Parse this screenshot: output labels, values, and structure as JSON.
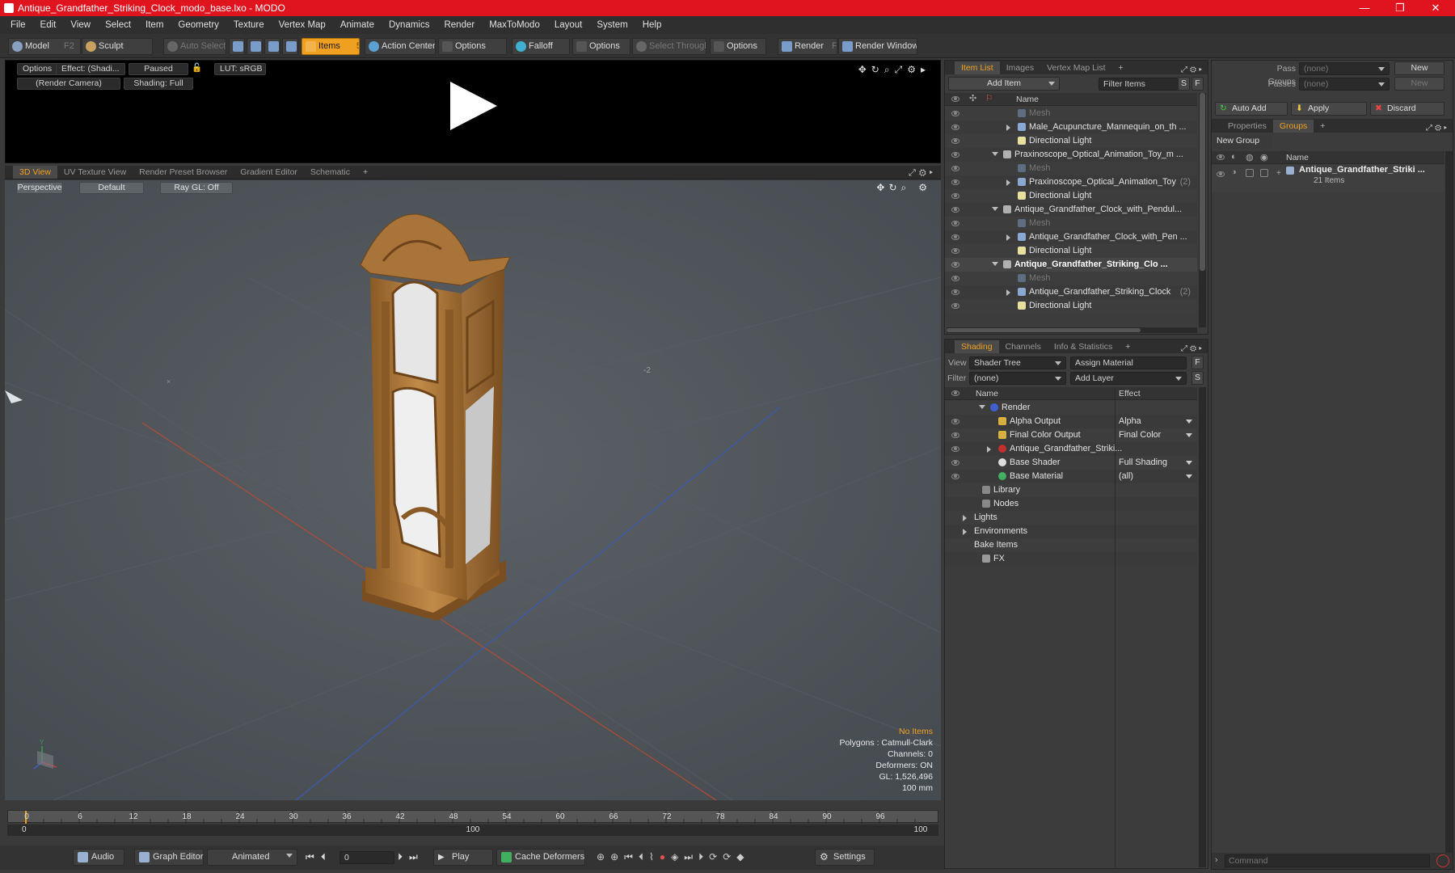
{
  "window": {
    "title": "Antique_Grandfather_Striking_Clock_modo_base.lxo - MODO",
    "controls": [
      "—",
      "❐",
      "✕"
    ],
    "accent": "#e0141e"
  },
  "menu": [
    "File",
    "Edit",
    "View",
    "Select",
    "Item",
    "Geometry",
    "Texture",
    "Vertex Map",
    "Animate",
    "Dynamics",
    "Render",
    "MaxToModo",
    "Layout",
    "System",
    "Help"
  ],
  "toolbar": {
    "model": "Model",
    "model_key": "F2",
    "sculpt": "Sculpt",
    "auto_select": "Auto Select",
    "items": "Items",
    "items_key": "5",
    "action_center": "Action Center",
    "options1": "Options",
    "falloff": "Falloff",
    "options2": "Options",
    "select_through": "Select Through",
    "options3": "Options",
    "render": "Render",
    "render_key": "F9",
    "render_window": "Render Window"
  },
  "preview": {
    "options": "Options",
    "effect": "Effect: (Shadi...",
    "paused": "Paused",
    "lut": "LUT: sRGB",
    "camera": "(Render Camera)",
    "shading": "Shading: Full"
  },
  "viewport_tabs": [
    "3D View",
    "UV Texture View",
    "Render Preset Browser",
    "Gradient Editor",
    "Schematic",
    "+"
  ],
  "viewport": {
    "perspective": "Perspective",
    "default": "Default",
    "raygl": "Ray GL: Off",
    "info": {
      "items": "No Items",
      "polygons": "Polygons : Catmull-Clark",
      "channels": "Channels: 0",
      "deformers": "Deformers: ON",
      "gl": "GL: 1,526,496",
      "scale": "100 mm"
    },
    "axis_x": "X",
    "axis_y": "Y",
    "axis_z": "Z",
    "grid_label": "-2"
  },
  "timeline": {
    "ticks": [
      "0",
      "6",
      "12",
      "18",
      "24",
      "30",
      "36",
      "42",
      "48",
      "54",
      "60",
      "66",
      "72",
      "78",
      "84",
      "90",
      "96"
    ],
    "bottom": [
      "0",
      "100",
      "100"
    ],
    "current": "0"
  },
  "bottombar": {
    "audio": "Audio",
    "graph_editor": "Graph Editor",
    "animated": "Animated",
    "frame": "0",
    "play": "Play",
    "cache_deformers": "Cache Deformers",
    "settings": "Settings"
  },
  "item_list": {
    "tabs": [
      "Item List",
      "Images",
      "Vertex Map List",
      "+"
    ],
    "add_item": "Add Item",
    "filter": "Filter Items",
    "s": "S",
    "f": "F",
    "col_name": "Name",
    "rows": [
      {
        "label": "Mesh",
        "dim": true,
        "bold": false,
        "count": ""
      },
      {
        "label": "Male_Acupuncture_Mannequin_on_th ...",
        "dim": false,
        "bold": false,
        "count": ""
      },
      {
        "label": "Directional Light",
        "dim": false,
        "bold": false,
        "count": ""
      },
      {
        "label": "Praxinoscope_Optical_Animation_Toy_m ...",
        "dim": false,
        "bold": false,
        "count": ""
      },
      {
        "label": "Mesh",
        "dim": true,
        "bold": false,
        "count": ""
      },
      {
        "label": "Praxinoscope_Optical_Animation_Toy",
        "dim": false,
        "bold": false,
        "count": "(2)"
      },
      {
        "label": "Directional Light",
        "dim": false,
        "bold": false,
        "count": ""
      },
      {
        "label": "Antique_Grandfather_Clock_with_Pendul...",
        "dim": false,
        "bold": false,
        "count": ""
      },
      {
        "label": "Mesh",
        "dim": true,
        "bold": false,
        "count": ""
      },
      {
        "label": "Antique_Grandfather_Clock_with_Pen ...",
        "dim": false,
        "bold": false,
        "count": ""
      },
      {
        "label": "Directional Light",
        "dim": false,
        "bold": false,
        "count": ""
      },
      {
        "label": "Antique_Grandfather_Striking_Clo ...",
        "dim": false,
        "bold": true,
        "count": ""
      },
      {
        "label": "Mesh",
        "dim": true,
        "bold": false,
        "count": ""
      },
      {
        "label": "Antique_Grandfather_Striking_Clock",
        "dim": false,
        "bold": false,
        "count": "(2)"
      },
      {
        "label": "Directional Light",
        "dim": false,
        "bold": false,
        "count": ""
      }
    ]
  },
  "shading": {
    "tabs": [
      "Shading",
      "Channels",
      "Info & Statistics",
      "+"
    ],
    "view_label": "View",
    "view_value": "Shader Tree",
    "assign_material": "Assign Material",
    "filter_label": "Filter",
    "filter_value": "(none)",
    "add_layer": "Add Layer",
    "f": "F",
    "s": "S",
    "col_name": "Name",
    "col_effect": "Effect",
    "rows": [
      {
        "label": "Render",
        "effect": ""
      },
      {
        "label": "Alpha Output",
        "effect": "Alpha"
      },
      {
        "label": "Final Color Output",
        "effect": "Final Color"
      },
      {
        "label": "Antique_Grandfather_Striki...",
        "effect": ""
      },
      {
        "label": "Base Shader",
        "effect": "Full Shading"
      },
      {
        "label": "Base Material",
        "effect": "(all)"
      },
      {
        "label": "Library",
        "effect": ""
      },
      {
        "label": "Nodes",
        "effect": ""
      },
      {
        "label": "Lights",
        "effect": ""
      },
      {
        "label": "Environments",
        "effect": ""
      },
      {
        "label": "Bake Items",
        "effect": ""
      },
      {
        "label": "FX",
        "effect": ""
      }
    ]
  },
  "right_panel": {
    "pass_groups_label": "Pass Groups",
    "pass_groups_value": "(none)",
    "new1": "New",
    "passes_label": "Passes",
    "passes_value": "(none)",
    "new2": "New",
    "auto_add": "Auto Add",
    "apply": "Apply",
    "discard": "Discard",
    "tabs": [
      "Properties",
      "Groups",
      "+"
    ],
    "new_group": "New Group",
    "col_name": "Name",
    "group_name": "Antique_Grandfather_Striki ...",
    "group_items": "21 Items",
    "command_placeholder": "Command"
  },
  "colors": {
    "accent_orange": "#f0a020",
    "wood": "#b07a3a"
  }
}
